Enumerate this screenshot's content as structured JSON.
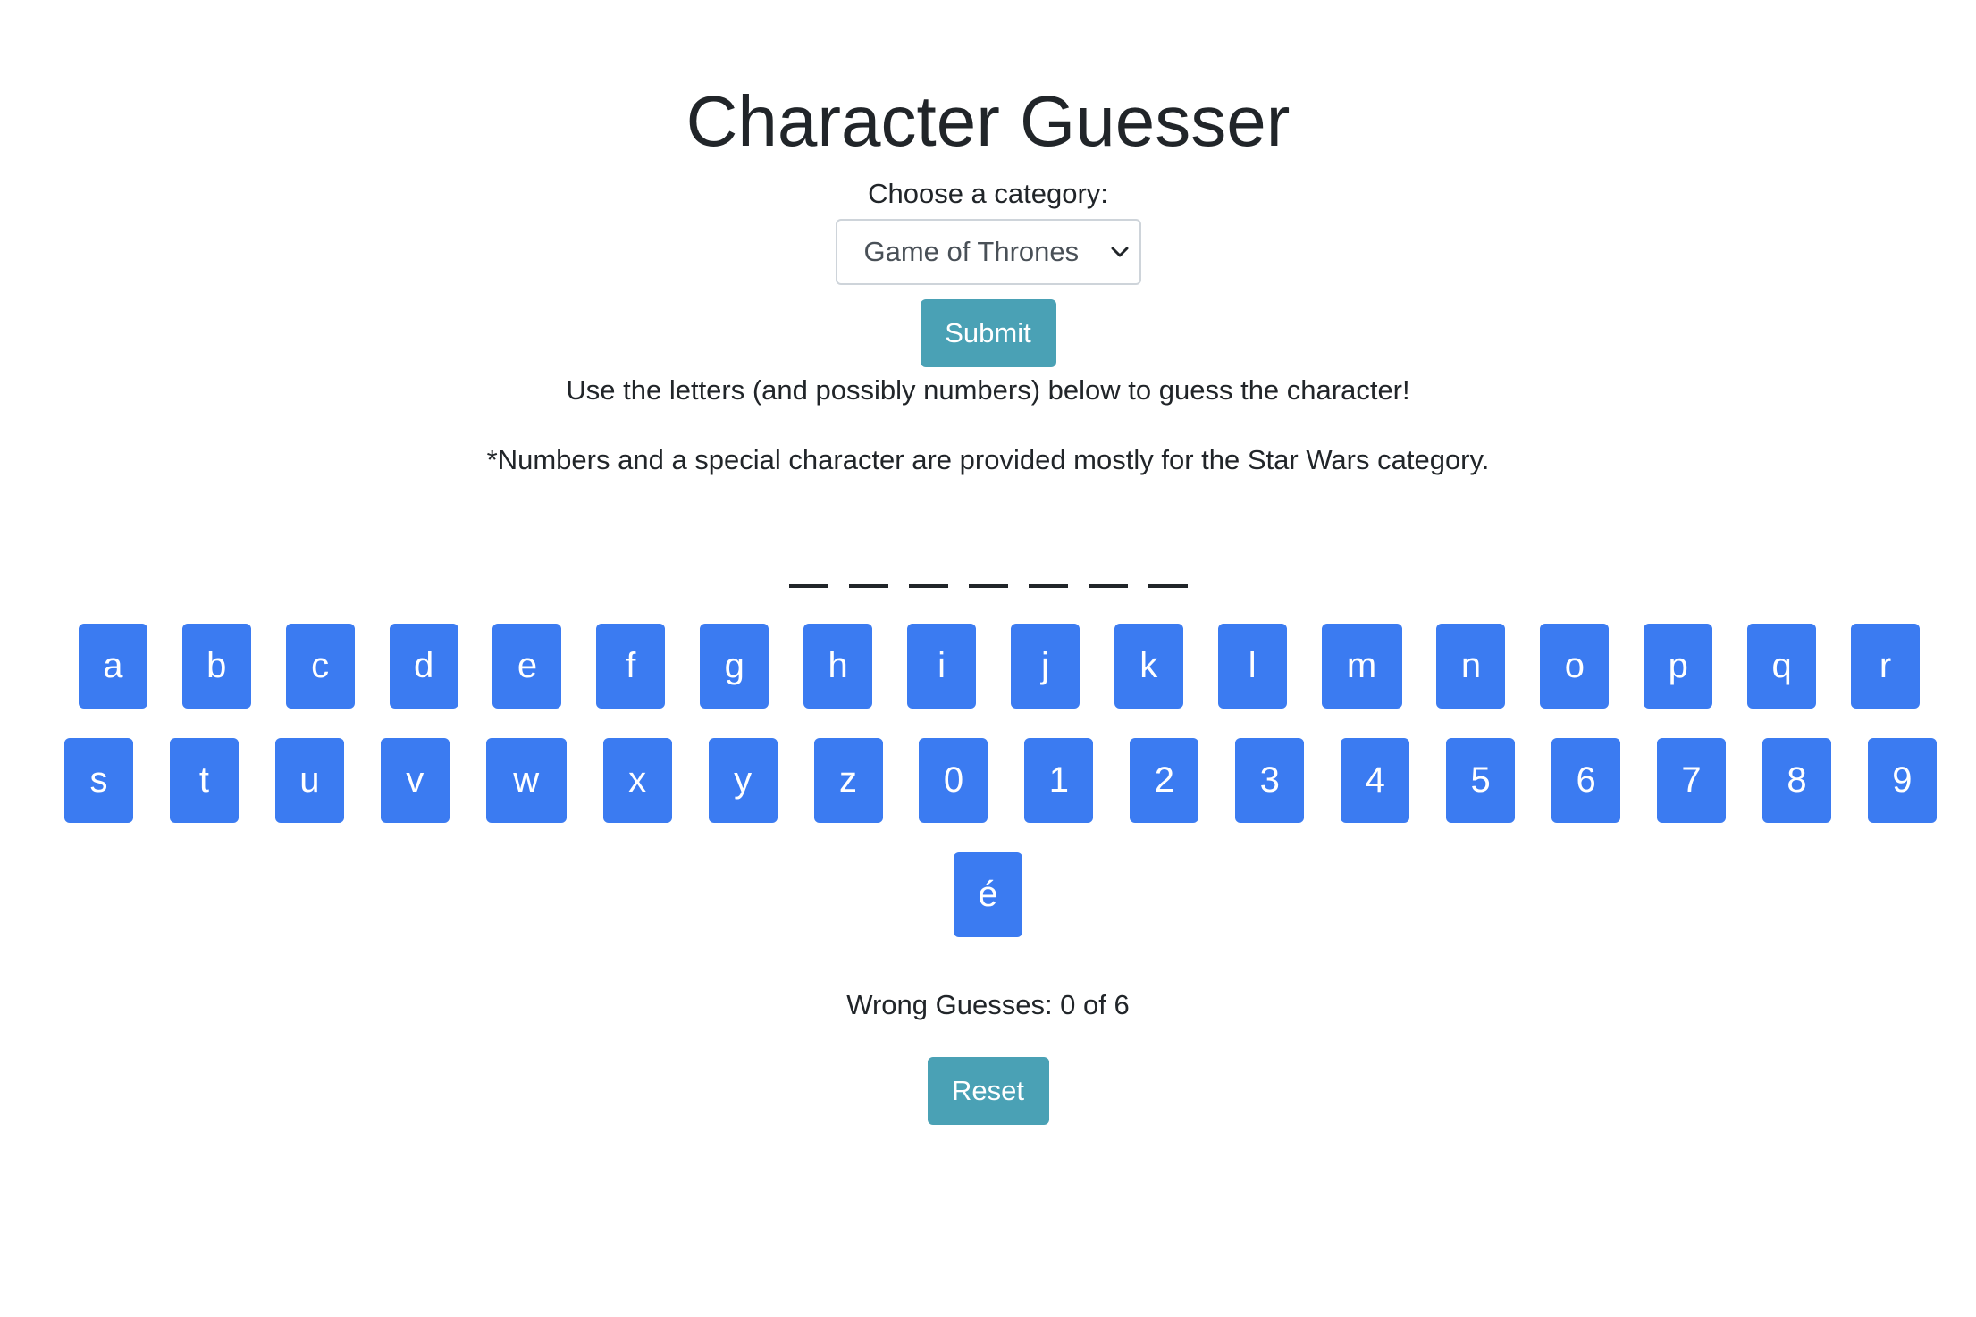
{
  "title": "Character Guesser",
  "category": {
    "label": "Choose a category:",
    "selected": "Game of Thrones"
  },
  "submit_label": "Submit",
  "instruction": "Use the letters (and possibly numbers) below to guess the character!",
  "footnote": "*Numbers and a special character are provided mostly for the Star Wars category.",
  "blanks_count": 7,
  "keys_row1": [
    "a",
    "b",
    "c",
    "d",
    "e",
    "f",
    "g",
    "h",
    "i",
    "j",
    "k",
    "l",
    "m",
    "n",
    "o",
    "p",
    "q",
    "r"
  ],
  "keys_row2": [
    "s",
    "t",
    "u",
    "v",
    "w",
    "x",
    "y",
    "z",
    "0",
    "1",
    "2",
    "3",
    "4",
    "5",
    "6",
    "7",
    "8",
    "9"
  ],
  "keys_row3": [
    "é"
  ],
  "wrong_guesses": "Wrong Guesses: 0 of 6",
  "reset_label": "Reset",
  "colors": {
    "key_blue": "#3b7bf1",
    "info_teal": "#4aa1b5"
  }
}
